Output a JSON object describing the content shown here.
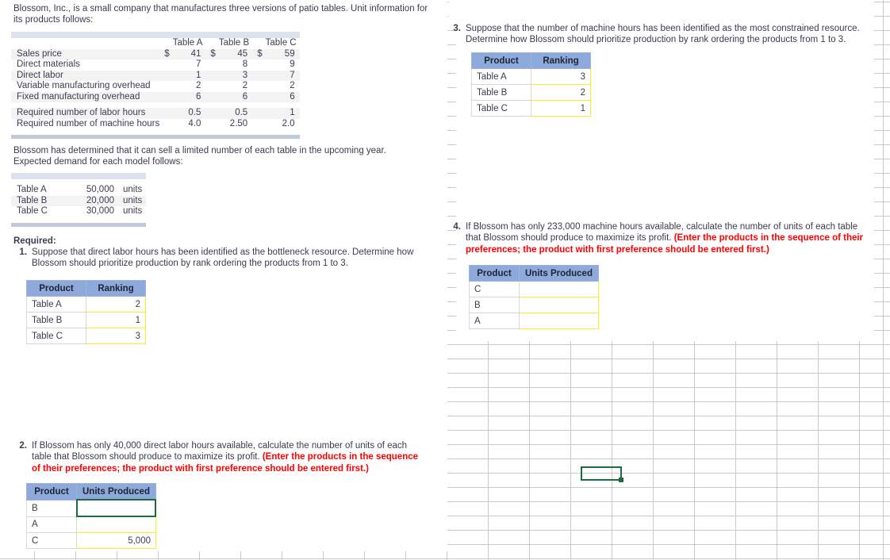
{
  "intro": {
    "paragraph": "Blossom, Inc., is a small company that manufactures three versions of patio tables. Unit information for its products follows:"
  },
  "unit_info_table": {
    "column_headers": [
      "",
      "Table A",
      "Table B",
      "Table C"
    ],
    "rows": [
      {
        "label": "Sales price",
        "currency": "$",
        "a": "41",
        "b": "45",
        "c": "59",
        "b_currency": "$",
        "c_currency": "$"
      },
      {
        "label": "Direct materials",
        "currency": "",
        "a": "7",
        "b": "8",
        "c": "9",
        "b_currency": "",
        "c_currency": ""
      },
      {
        "label": "Direct labor",
        "currency": "",
        "a": "1",
        "b": "3",
        "c": "7",
        "b_currency": "",
        "c_currency": ""
      },
      {
        "label": "Variable manufacturing overhead",
        "currency": "",
        "a": "2",
        "b": "2",
        "c": "2",
        "b_currency": "",
        "c_currency": ""
      },
      {
        "label": "Fixed manufacturing overhead",
        "currency": "",
        "a": "6",
        "b": "6",
        "c": "6",
        "b_currency": "",
        "c_currency": ""
      }
    ],
    "hours_rows": [
      {
        "label": "Required number of labor hours",
        "a": "0.5",
        "b": "0.5",
        "c": "1"
      },
      {
        "label": "Required number of machine hours",
        "a": "4.0",
        "b": "2.50",
        "c": "2.0"
      }
    ]
  },
  "demand": {
    "paragraph": "Blossom has determined that it can sell a limited number of each table in the upcoming year. Expected demand for each model follows:",
    "rows": [
      {
        "label": "Table A",
        "value": "50,000",
        "unit": "units"
      },
      {
        "label": "Table B",
        "value": "20,000",
        "unit": "units"
      },
      {
        "label": "Table C",
        "value": "30,000",
        "unit": "units"
      }
    ]
  },
  "required_heading": "Required:",
  "questions": {
    "q1": {
      "number": "1.",
      "text": "Suppose that direct labor hours has been identified as the bottleneck resource. Determine how Blossom should prioritize production by rank ordering the products from 1 to 3.",
      "table": {
        "headers": [
          "Product",
          "Ranking"
        ],
        "rows": [
          {
            "product": "Table A",
            "value": "2"
          },
          {
            "product": "Table B",
            "value": "1"
          },
          {
            "product": "Table C",
            "value": "3"
          }
        ]
      }
    },
    "q2": {
      "number": "2.",
      "text_plain": "If Blossom has only 40,000 direct labor hours available, calculate the number of units of each table that Blossom should produce to maximize its profit. ",
      "text_red": "(Enter the products in the sequence of their preferences; the product with first preference should be entered first.)",
      "table": {
        "headers": [
          "Product",
          "Units Produced"
        ],
        "rows": [
          {
            "product": "B",
            "value": ""
          },
          {
            "product": "A",
            "value": ""
          },
          {
            "product": "C",
            "value": "5,000"
          }
        ]
      }
    },
    "q3": {
      "number": "3.",
      "text": "Suppose that the number of machine hours has been identified as the most constrained resource. Determine how Blossom should prioritize production by rank ordering the products from 1 to 3.",
      "table": {
        "headers": [
          "Product",
          "Ranking"
        ],
        "rows": [
          {
            "product": "Table A",
            "value": "3"
          },
          {
            "product": "Table B",
            "value": "2"
          },
          {
            "product": "Table C",
            "value": "1"
          }
        ]
      }
    },
    "q4": {
      "number": "4.",
      "text_plain": "If Blossom has only 233,000 machine hours available, calculate the number of units of each table that Blossom should produce to maximize its profit. ",
      "text_red": "(Enter the products in the sequence of their preferences; the product with first preference should be entered first.)",
      "table": {
        "headers": [
          "Product",
          "Units Produced"
        ],
        "rows": [
          {
            "product": "C",
            "value": ""
          },
          {
            "product": "B",
            "value": ""
          },
          {
            "product": "A",
            "value": ""
          }
        ]
      }
    }
  },
  "colors": {
    "input_border": "#f2f21f",
    "selection_border": "#1f6b40",
    "table_header": "#8ea9db",
    "band_header": "#dde3ee",
    "band_footer": "#bfcbdd",
    "alert_text": "#ff0000"
  }
}
